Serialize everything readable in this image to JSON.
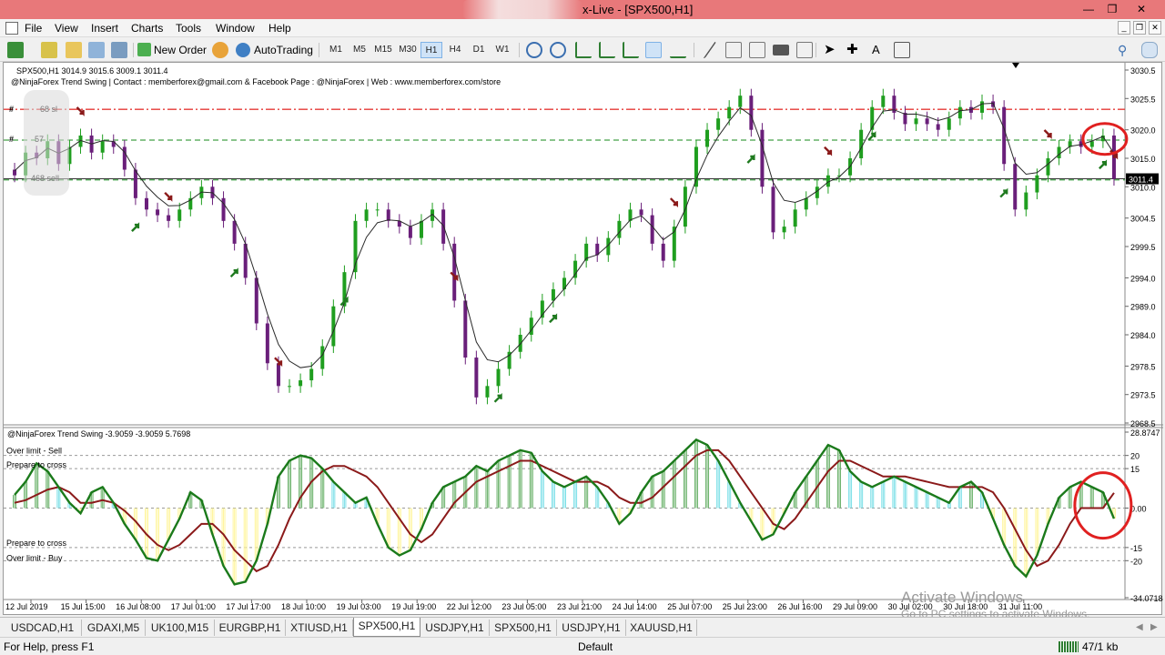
{
  "window": {
    "title": "x-Live - [SPX500,H1]",
    "min_icon": "minimize-icon",
    "max_icon": "restore-icon",
    "close_icon": "close-icon"
  },
  "menu": [
    "File",
    "View",
    "Insert",
    "Charts",
    "Tools",
    "Window",
    "Help"
  ],
  "toolbar": {
    "new_order": "New Order",
    "autotrading": "AutoTrading",
    "timeframes": [
      "M1",
      "M5",
      "M15",
      "M30",
      "H1",
      "H4",
      "D1",
      "W1"
    ],
    "active_timeframe": "H1"
  },
  "chart_data": [
    {
      "type": "candlestick",
      "header": "SPX500,H1  3014.9 3015.6 3009.1 3011.4",
      "indicator_caption": "@NinjaForex Trend Swing | Contact : memberforex@gmail.com & Facebook Page : @NinjaForex | Web : www.memberforex.com/store",
      "y_ticks": [
        "3030.5",
        "3025.5",
        "3020.0",
        "3015.0",
        "3010.0",
        "3004.5",
        "2999.5",
        "2994.0",
        "2989.0",
        "2984.0",
        "2978.5",
        "2973.5",
        "2968.5"
      ],
      "current_price": "3011.4",
      "ylim": [
        2968.5,
        3030.5
      ],
      "level_labels": [
        "#",
        "68 sl",
        "#",
        "57",
        "468 sell"
      ],
      "series": [
        {
          "name": "close",
          "values": [
            3012,
            3016,
            3015,
            3018,
            3014,
            3017,
            3019,
            3016,
            3018,
            3017,
            3013,
            3008,
            3006,
            3005,
            3004,
            3006,
            3008,
            3010,
            3008,
            3004,
            3000,
            2994,
            2986,
            2979,
            2975,
            2975,
            2976,
            2978,
            2982,
            2989,
            2995,
            3004,
            3006,
            3006,
            3004,
            3003,
            3001,
            3004,
            3006,
            3000,
            2990,
            2980,
            2973,
            2975,
            2978,
            2981,
            2984,
            2987,
            2990,
            2992,
            2994,
            2997,
            3000,
            2998,
            3001,
            3004,
            3006,
            3005,
            3000,
            2997,
            3003,
            3010,
            3017,
            3020,
            3022,
            3024,
            3026,
            3020,
            3010,
            3002,
            3003,
            3006,
            3008,
            3010,
            3012,
            3012,
            3015,
            3020,
            3024,
            3026,
            3023,
            3021,
            3022,
            3021,
            3020,
            3022,
            3024,
            3023,
            3025,
            3024,
            3014,
            3006,
            3009,
            3012,
            3015,
            3017,
            3018,
            3017,
            3018,
            3019,
            3011.4
          ]
        }
      ],
      "annotations": [
        "sell-arrows",
        "buy-arrows",
        "red-circle"
      ]
    },
    {
      "type": "oscillator",
      "header": "@NinjaForex Trend Swing -3.9059 -3.9059 5.7698",
      "y_ticks": [
        "28.8747",
        "20",
        "15",
        "0.00",
        "-15",
        "-20",
        "-34.0718"
      ],
      "ylim": [
        -34.0718,
        28.8747
      ],
      "levels": [
        20,
        15,
        -15,
        -20
      ],
      "level_labels": [
        "Over limit - Sell",
        "Prepare to cross",
        "Prepare to cross",
        "Over limit - Buy"
      ],
      "series": [
        {
          "name": "fast",
          "values": [
            5,
            10,
            17,
            14,
            8,
            2,
            -2,
            6,
            8,
            2,
            -6,
            -12,
            -19,
            -20,
            -12,
            -4,
            6,
            3,
            -10,
            -22,
            -29,
            -28,
            -20,
            -6,
            12,
            18,
            20,
            19,
            15,
            10,
            6,
            2,
            4,
            -6,
            -15,
            -18,
            -16,
            -8,
            2,
            8,
            10,
            12,
            16,
            14,
            18,
            20,
            22,
            21,
            14,
            10,
            8,
            10,
            12,
            8,
            2,
            -6,
            -2,
            6,
            12,
            14,
            18,
            22,
            26,
            24,
            18,
            10,
            2,
            -5,
            -12,
            -10,
            -2,
            6,
            12,
            18,
            24,
            22,
            14,
            10,
            8,
            10,
            12,
            10,
            8,
            6,
            4,
            2,
            8,
            10,
            6,
            -4,
            -14,
            -22,
            -26,
            -18,
            -6,
            4,
            8,
            10,
            8,
            6,
            -4
          ]
        },
        {
          "name": "slow",
          "values": [
            2,
            3,
            5,
            7,
            8,
            6,
            2,
            2,
            3,
            2,
            -1,
            -5,
            -10,
            -14,
            -16,
            -14,
            -10,
            -6,
            -6,
            -10,
            -16,
            -20,
            -24,
            -22,
            -14,
            -4,
            4,
            10,
            14,
            16,
            16,
            14,
            12,
            8,
            2,
            -4,
            -10,
            -13,
            -10,
            -4,
            2,
            6,
            10,
            12,
            14,
            16,
            18,
            18,
            16,
            14,
            12,
            10,
            10,
            10,
            8,
            4,
            2,
            2,
            4,
            8,
            12,
            16,
            20,
            22,
            22,
            18,
            12,
            6,
            0,
            -6,
            -8,
            -4,
            2,
            8,
            14,
            18,
            18,
            16,
            14,
            12,
            12,
            12,
            11,
            10,
            9,
            8,
            8,
            8,
            8,
            6,
            0,
            -8,
            -16,
            -22,
            -20,
            -14,
            -6,
            0,
            0,
            0,
            5.7698
          ]
        }
      ]
    }
  ],
  "x_ticks": [
    "12 Jul 2019",
    "15 Jul 15:00",
    "16 Jul 08:00",
    "17 Jul 01:00",
    "17 Jul 17:00",
    "18 Jul 10:00",
    "19 Jul 03:00",
    "19 Jul 19:00",
    "22 Jul 12:00",
    "23 Jul 05:00",
    "23 Jul 21:00",
    "24 Jul 14:00",
    "25 Jul 07:00",
    "25 Jul 23:00",
    "26 Jul 16:00",
    "29 Jul 09:00",
    "30 Jul 02:00",
    "30 Jul 18:00",
    "31 Jul 11:00"
  ],
  "tabs": [
    "USDCAD,H1",
    "GDAXI,M5",
    "UK100,M15",
    "EURGBP,H1",
    "XTIUSD,H1",
    "SPX500,H1",
    "USDJPY,H1",
    "SPX500,H1",
    "USDJPY,H1",
    "XAUUSD,H1"
  ],
  "active_tab": 5,
  "status": {
    "help": "For Help, press F1",
    "profile": "Default",
    "traffic": "47/1 kb"
  },
  "watermark": {
    "line1": "Activate Windows",
    "line2": "Go to PC settings to activate Windows."
  },
  "colors": {
    "bull": "#1f9e1f",
    "bear": "#6a1f7a",
    "sell_arrow": "#8b1a1a",
    "buy_arrow": "#1f7a1f",
    "resistance": "#e53935",
    "support": "#43a047",
    "osc_fast": "#1b7a1b",
    "osc_slow": "#8b1a1a"
  }
}
